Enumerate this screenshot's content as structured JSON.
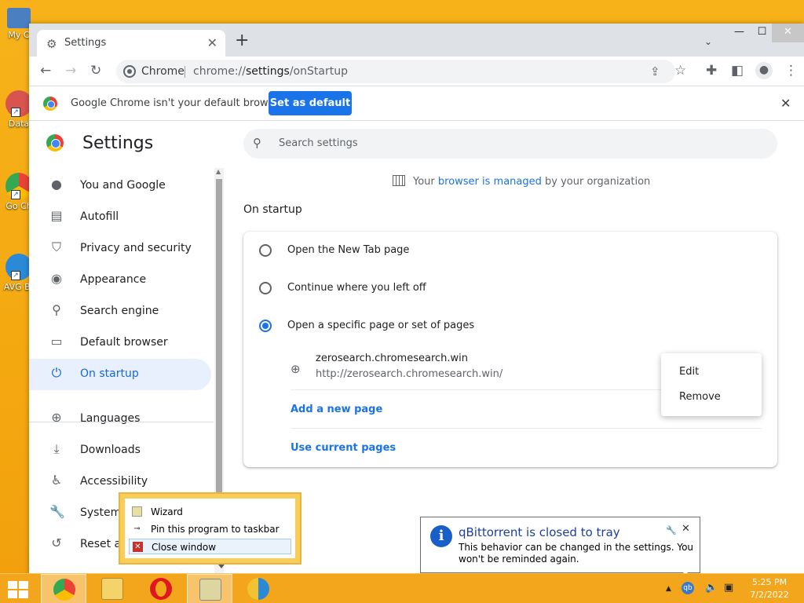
{
  "desktop": {
    "icons": [
      {
        "label": "My C"
      },
      {
        "label": "Data"
      },
      {
        "label": "Go Ch"
      },
      {
        "label": "AVG Br"
      }
    ]
  },
  "browser": {
    "tab": {
      "title": "Settings",
      "close": "✕"
    },
    "new_tab": "+",
    "tab_search": "⌄",
    "window_controls": {
      "minimize": "—",
      "maximize": "☐",
      "close": "✕"
    },
    "toolbar": {
      "site_label": "Chrome",
      "url_scheme": "chrome://",
      "url_host": "settings",
      "url_path": "/onStartup"
    },
    "infobar": {
      "message": "Google Chrome isn't your default browser",
      "button": "Set as default",
      "close": "✕"
    }
  },
  "settings": {
    "title": "Settings",
    "search_placeholder": "Search settings",
    "managed_prefix": "Your ",
    "managed_link": "browser is managed",
    "managed_suffix": " by your organization",
    "nav": [
      {
        "label": "You and Google",
        "icon": "person-icon"
      },
      {
        "label": "Autofill",
        "icon": "autofill-icon"
      },
      {
        "label": "Privacy and security",
        "icon": "shield-icon"
      },
      {
        "label": "Appearance",
        "icon": "palette-icon"
      },
      {
        "label": "Search engine",
        "icon": "search-icon"
      },
      {
        "label": "Default browser",
        "icon": "browser-icon"
      },
      {
        "label": "On startup",
        "icon": "power-icon",
        "active": true
      },
      {
        "label": "Languages",
        "icon": "globe-icon"
      },
      {
        "label": "Downloads",
        "icon": "download-icon"
      },
      {
        "label": "Accessibility",
        "icon": "accessibility-icon"
      },
      {
        "label": "System",
        "icon": "wrench-icon"
      },
      {
        "label": "Reset and clean up",
        "icon": "history-icon"
      }
    ],
    "section_title": "On startup",
    "options": [
      {
        "label": "Open the New Tab page",
        "selected": false
      },
      {
        "label": "Continue where you left off",
        "selected": false
      },
      {
        "label": "Open a specific page or set of pages",
        "selected": true
      }
    ],
    "startup_page": {
      "name": "zerosearch.chromesearch.win",
      "url": "http://zerosearch.chromesearch.win/"
    },
    "add_page": "Add a new page",
    "use_current": "Use current pages",
    "menu": {
      "edit": "Edit",
      "remove": "Remove"
    }
  },
  "jumplist": {
    "items": [
      {
        "label": "Wizard"
      },
      {
        "label": "Pin this program to taskbar"
      },
      {
        "label": "Close window"
      }
    ]
  },
  "notification": {
    "title": "qBittorrent is closed to tray",
    "body": "This behavior can be changed in the settings. You won't be reminded again."
  },
  "taskbar": {
    "time": "5:25 PM",
    "date": "7/2/2022"
  },
  "colors": {
    "accent": "#1a73e8",
    "taskbar": "#f3a51c",
    "active_nav": "#e8f0fe"
  }
}
